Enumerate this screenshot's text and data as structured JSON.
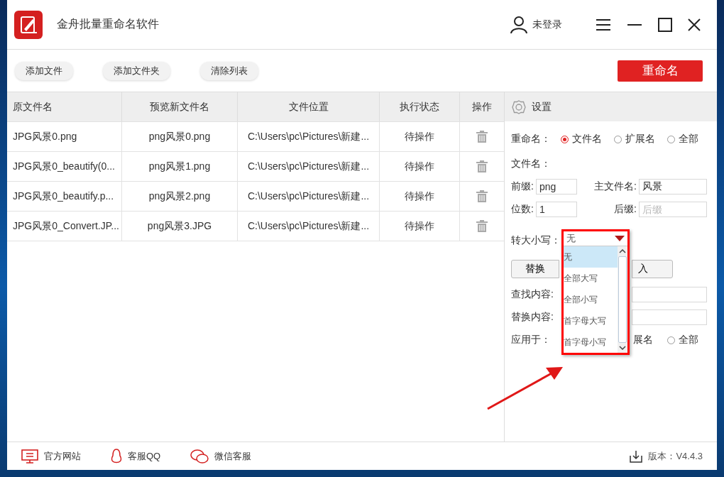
{
  "window": {
    "title": "金舟批量重命名软件",
    "user": "未登录"
  },
  "toolbar": {
    "buttons": [
      "添加文件",
      "添加文件夹",
      "清除列表"
    ],
    "primary": "重命名"
  },
  "table": {
    "columns": [
      "原文件名",
      "预览新文件名",
      "文件位置",
      "执行状态",
      "操作"
    ],
    "rows": [
      {
        "original": "JPG风景0.png",
        "preview": "png风景0.png",
        "location": "C:\\Users\\pc\\Pictures\\新建...",
        "status": "待操作"
      },
      {
        "original": "JPG风景0_beautify(0...",
        "preview": "png风景1.png",
        "location": "C:\\Users\\pc\\Pictures\\新建...",
        "status": "待操作"
      },
      {
        "original": "JPG风景0_beautify.p...",
        "preview": "png风景2.png",
        "location": "C:\\Users\\pc\\Pictures\\新建...",
        "status": "待操作"
      },
      {
        "original": "JPG风景0_Convert.JP...",
        "preview": "png风景3.JPG",
        "location": "C:\\Users\\pc\\Pictures\\新建...",
        "status": "待操作"
      }
    ]
  },
  "settings": {
    "title": "设置",
    "rename": {
      "label": "重命名：",
      "options": [
        {
          "label": "文件名",
          "selected": true
        },
        {
          "label": "扩展名",
          "selected": false
        },
        {
          "label": "全部",
          "selected": false
        }
      ]
    },
    "filename_label": "文件名：",
    "prefix": {
      "label": "前缀:",
      "value": "png"
    },
    "main_name": {
      "label": "主文件名:",
      "value": "风景"
    },
    "digits": {
      "label": "位数:",
      "value": "1"
    },
    "suffix": {
      "label": "后缀:",
      "placeholder": "后缀"
    },
    "case": {
      "label": "转大小写：",
      "value": "无",
      "options": [
        {
          "label": "无",
          "selected": true
        },
        {
          "label": "全部大写",
          "selected": false
        },
        {
          "label": "全部小写",
          "selected": false
        },
        {
          "label": "首字母大写",
          "selected": false
        },
        {
          "label": "首字母小写",
          "selected": false
        }
      ]
    },
    "buttons": [
      "替换",
      "入"
    ],
    "find_label": "查找内容:",
    "replace_label": "替换内容:",
    "apply_to": {
      "label": "应用于：",
      "covered_text": "展名",
      "options": [
        {
          "label": "全部",
          "selected": false
        }
      ]
    }
  },
  "footer": {
    "links": [
      "官方网站",
      "客服QQ",
      "微信客服"
    ],
    "version": "版本：V4.4.3"
  }
}
